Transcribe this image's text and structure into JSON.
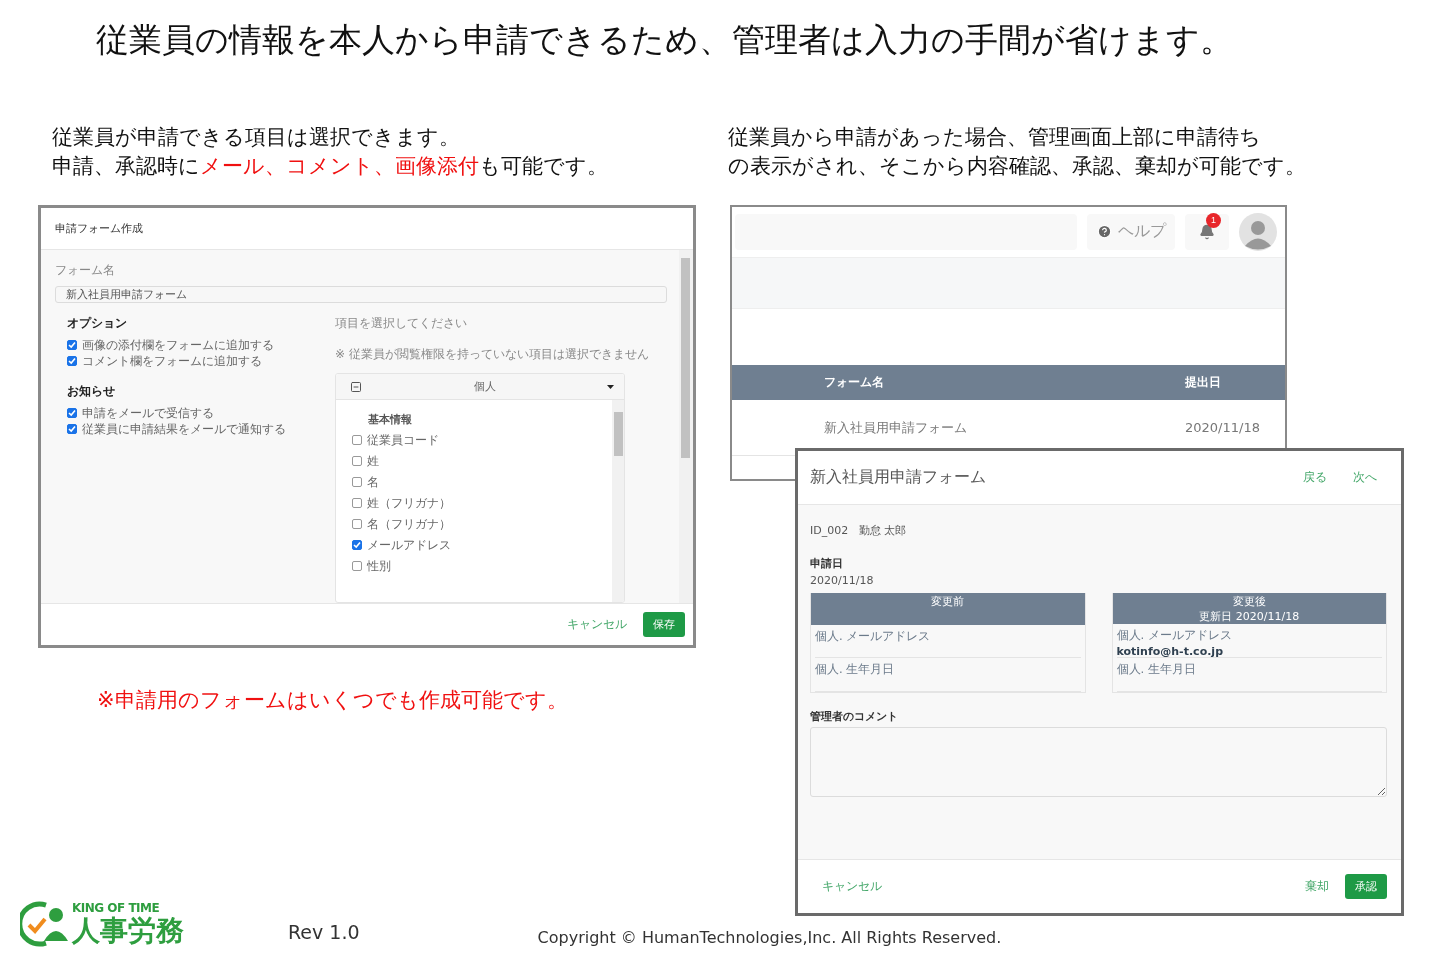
{
  "title": "従業員の情報を本人から申請できるため、管理者は入力の手間が省けます。",
  "left": {
    "caption_lines": [
      [
        {
          "text": "従業員が申請できる項目は選択できます。",
          "highlight": false
        }
      ],
      [
        {
          "text": "申請、承認時に",
          "highlight": false
        },
        {
          "text": "メール、コメント、画像添付",
          "highlight": true
        },
        {
          "text": "も可能です。",
          "highlight": false
        }
      ]
    ],
    "form_editor": {
      "title": "申請フォーム作成",
      "form_name_label": "フォーム名",
      "form_name_value": "新入社員用申請フォーム",
      "groups": [
        {
          "heading": "オプション",
          "items": [
            {
              "label": "画像の添付欄をフォームに追加する",
              "checked": true
            },
            {
              "label": "コメント欄をフォームに追加する",
              "checked": true
            }
          ]
        },
        {
          "heading": "お知らせ",
          "items": [
            {
              "label": "申請をメールで受信する",
              "checked": true
            },
            {
              "label": "従業員に申請結果をメールで通知する",
              "checked": true
            }
          ]
        }
      ],
      "select_hint": "項目を選択してください",
      "select_note": "※ 従業員が閲覧権限を持っていない項目は選択できません",
      "category": "個人",
      "section": "基本情報",
      "fields": [
        {
          "label": "従業員コード",
          "checked": false
        },
        {
          "label": "姓",
          "checked": false
        },
        {
          "label": "名",
          "checked": false
        },
        {
          "label": "姓（フリガナ）",
          "checked": false
        },
        {
          "label": "名（フリガナ）",
          "checked": false
        },
        {
          "label": "メールアドレス",
          "checked": true
        },
        {
          "label": "性別",
          "checked": false
        }
      ],
      "cancel": "キャンセル",
      "save": "保存"
    },
    "note": "※申請用のフォームはいくつでも作成可能です。"
  },
  "right": {
    "caption_lines": [
      [
        {
          "text": "従業員から申請があった場合、管理画面上部に申請待ち",
          "highlight": false
        }
      ],
      [
        {
          "text": "の表示がされ、そこから内容確認、承認、棄却が可能です。",
          "highlight": false
        }
      ]
    ],
    "admin_screen": {
      "help": "ヘルプ",
      "badge": "1",
      "columns": [
        "フォーム名",
        "提出日"
      ],
      "rows": [
        {
          "form": "新入社員用申請フォーム",
          "date": "2020/11/18"
        }
      ]
    },
    "review_dialog": {
      "title": "新入社員用申請フォーム",
      "back": "戻る",
      "next": "次へ",
      "applicant": "ID_002   勤怠 太郎",
      "applied_label": "申請日",
      "applied_date": "2020/11/18",
      "panels": [
        {
          "heading": "変更前",
          "rows": [
            {
              "label": "個人. メールアドレス",
              "value": ""
            },
            {
              "label": "個人. 生年月日",
              "value": ""
            }
          ]
        },
        {
          "heading": "変更後",
          "subheading": "更新日 2020/11/18",
          "rows": [
            {
              "label": "個人. メールアドレス",
              "value": "kotinfo@h-t.co.jp"
            },
            {
              "label": "個人. 生年月日",
              "value": ""
            }
          ]
        }
      ],
      "comment_label": "管理者のコメント",
      "cancel": "キャンセル",
      "reject": "棄却",
      "approve": "承認"
    }
  },
  "footer": {
    "logo_tagline": "KING OF TIME",
    "logo_name": "人事労務",
    "rev": "Rev 1.0",
    "copyright": "Copyright © HumanTechnologies,Inc. All Rights Reserved."
  }
}
